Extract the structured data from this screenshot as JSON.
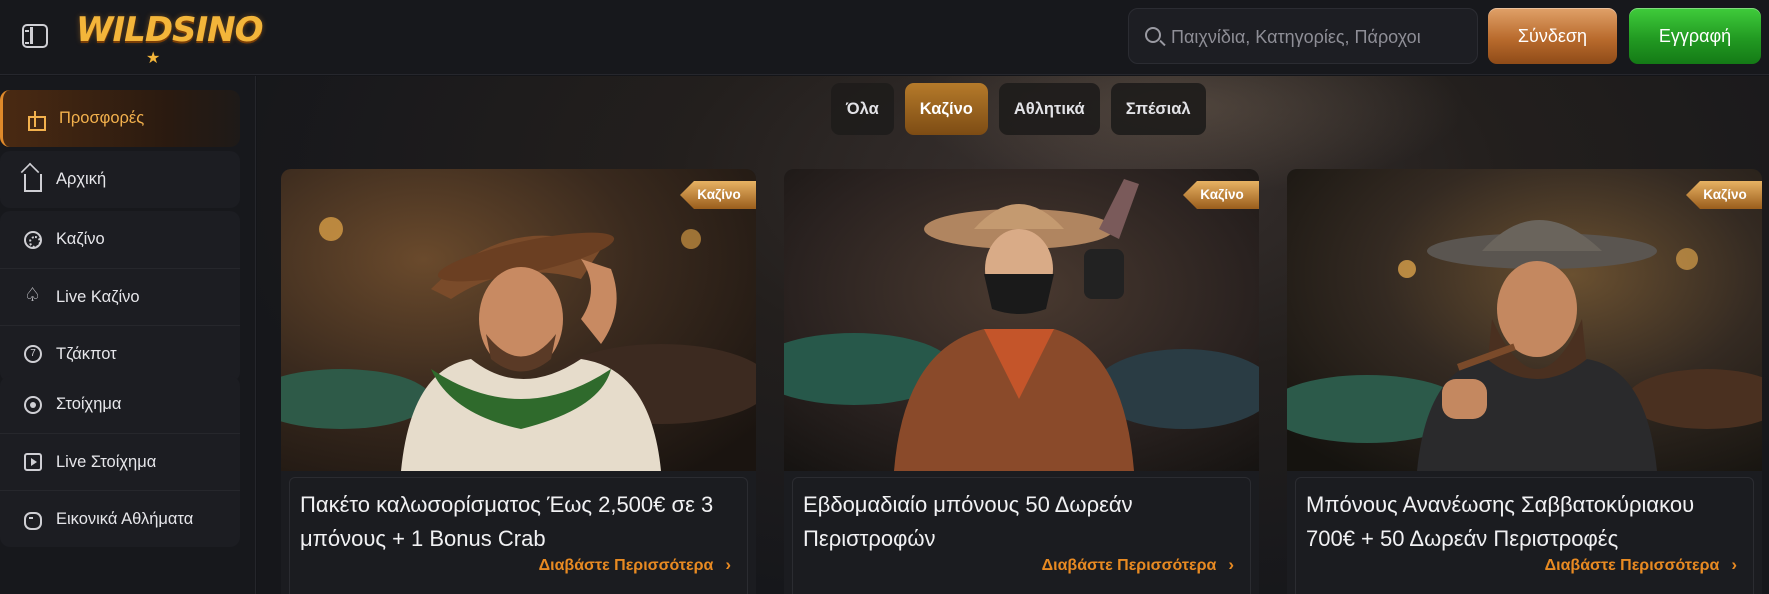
{
  "header": {
    "logo_text": "WILDSINO",
    "search_placeholder": "Παιχνίδια, Κατηγορίες, Πάροχοι",
    "login_label": "Σύνδεση",
    "register_label": "Εγγραφή"
  },
  "sidebar": {
    "promo_label": "Προσφορές",
    "home_label": "Αρχική",
    "items": [
      {
        "label": "Καζίνο",
        "icon": "chip-icon"
      },
      {
        "label": "Live Καζίνο",
        "icon": "spade-icon"
      },
      {
        "label": "Τζάκποτ",
        "icon": "jackpot-icon"
      },
      {
        "label": "Στοίχημα",
        "icon": "ball-icon"
      },
      {
        "label": "Live Στοίχημα",
        "icon": "play-icon"
      },
      {
        "label": "Εικονικά Αθλήματα",
        "icon": "gamepad-icon"
      }
    ]
  },
  "filters": {
    "tabs": [
      "Όλα",
      "Καζίνο",
      "Αθλητικά",
      "Σπέσιαλ"
    ],
    "active": "Καζίνο"
  },
  "cards": [
    {
      "tag": "Καζίνο",
      "title": "Πακέτο καλωσορίσματος Έως 2,500€ σε 3 μπόνους + 1 Bonus Crab",
      "link": "Διαβάστε Περισσότερα"
    },
    {
      "tag": "Καζίνο",
      "title": "Εβδομαδιαίο μπόνους 50 Δωρεάν Περιστροφών",
      "link": "Διαβάστε Περισσότερα"
    },
    {
      "tag": "Καζίνο",
      "title": "Μπόνους Ανανέωσης Σαββατοκύριακου 700€ + 50 Δωρεάν Περιστροφές",
      "link": "Διαβάστε Περισσότερα"
    }
  ],
  "colors": {
    "accent": "#e88a22",
    "login": "#b96b2d",
    "register": "#229a22",
    "background": "#141519"
  }
}
